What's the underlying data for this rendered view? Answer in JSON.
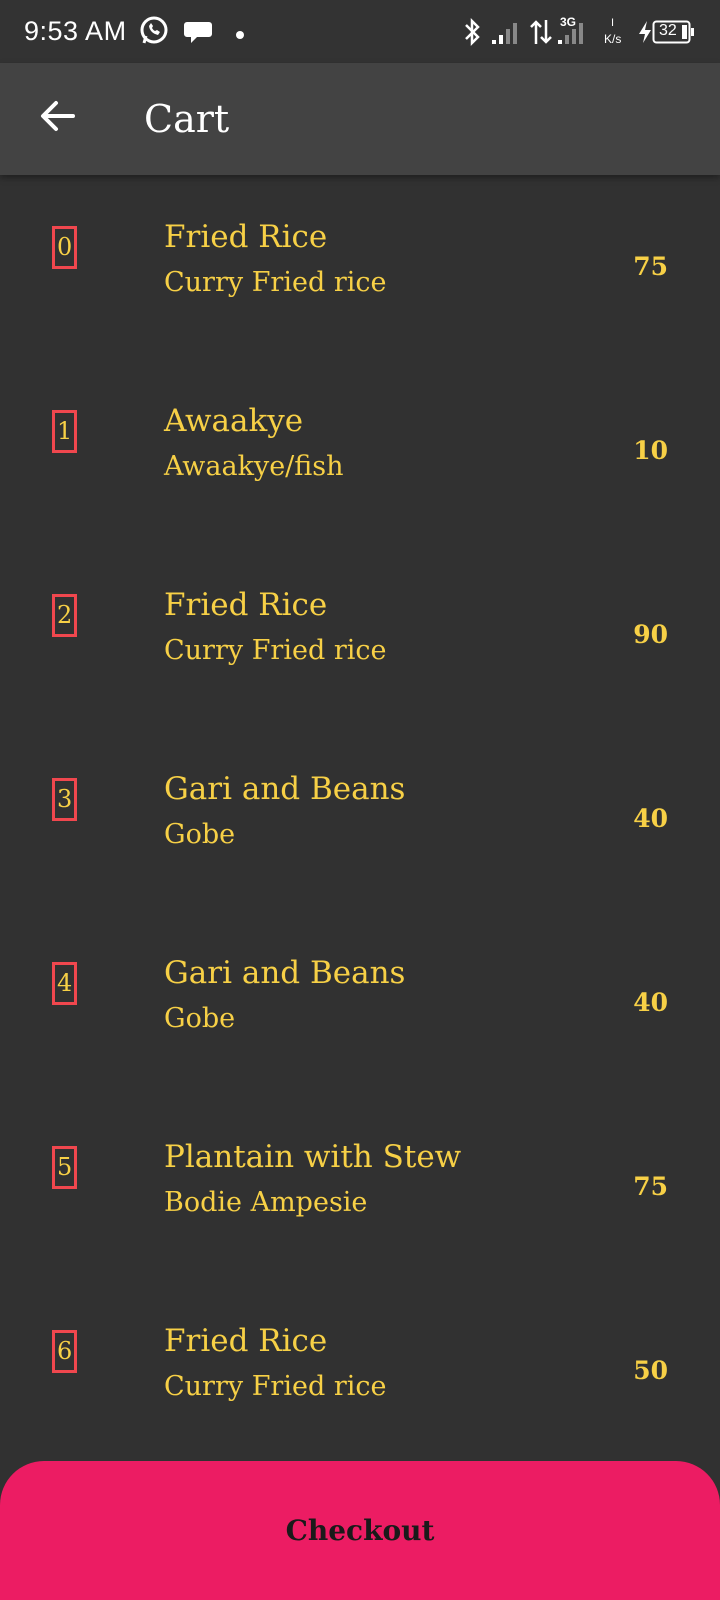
{
  "status_bar": {
    "time": "9:53 AM",
    "network_type": "3G",
    "speed_value": "I",
    "speed_unit": "K/s",
    "battery_level": "32",
    "icons": [
      "whatsapp-icon",
      "chat-icon",
      "dot-icon",
      "bluetooth-icon",
      "signal-icon",
      "data-arrows-icon",
      "signal-3g-icon",
      "charging-icon",
      "battery-icon"
    ]
  },
  "app_bar": {
    "title": "Cart",
    "back_icon": "arrow-back-icon"
  },
  "cart": {
    "items": [
      {
        "index": "0",
        "name": "Fried Rice",
        "description": "Curry Fried rice",
        "price": "75"
      },
      {
        "index": "1",
        "name": "Awaakye",
        "description": "Awaakye/fish",
        "price": "10"
      },
      {
        "index": "2",
        "name": "Fried Rice",
        "description": "Curry Fried rice",
        "price": "90"
      },
      {
        "index": "3",
        "name": "Gari and Beans",
        "description": "Gobe",
        "price": "40"
      },
      {
        "index": "4",
        "name": "Gari and Beans",
        "description": "Gobe",
        "price": "40"
      },
      {
        "index": "5",
        "name": "Plantain with Stew",
        "description": "Bodie Ampesie",
        "price": "75"
      },
      {
        "index": "6",
        "name": "Fried Rice",
        "description": "Curry Fried rice",
        "price": "50"
      }
    ]
  },
  "checkout": {
    "label": "Checkout"
  },
  "colors": {
    "background": "#313131",
    "app_bar": "#434343",
    "text_accent": "#f7d046",
    "index_border": "#f0474e",
    "checkout": "#ec1c63"
  }
}
